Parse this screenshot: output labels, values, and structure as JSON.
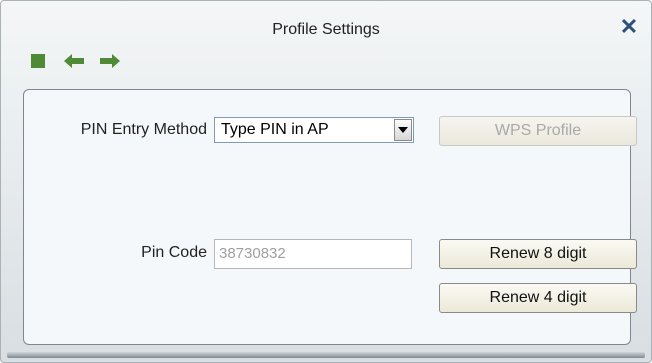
{
  "window": {
    "title": "Profile Settings"
  },
  "toolbar": {
    "items": [
      {
        "icon": "stop-square-icon"
      },
      {
        "icon": "arrow-left-icon"
      },
      {
        "icon": "arrow-right-icon"
      }
    ],
    "accent_color": "#4f8a37"
  },
  "form": {
    "pin_entry_method": {
      "label": "PIN Entry Method",
      "value": "Type PIN in AP"
    },
    "wps_profile_button": {
      "label": "WPS Profile",
      "enabled": false
    },
    "pin_code": {
      "label": "Pin Code",
      "value": "38730832"
    },
    "renew8_button": {
      "label": "Renew 8 digit"
    },
    "renew4_button": {
      "label": "Renew 4 digit"
    }
  }
}
